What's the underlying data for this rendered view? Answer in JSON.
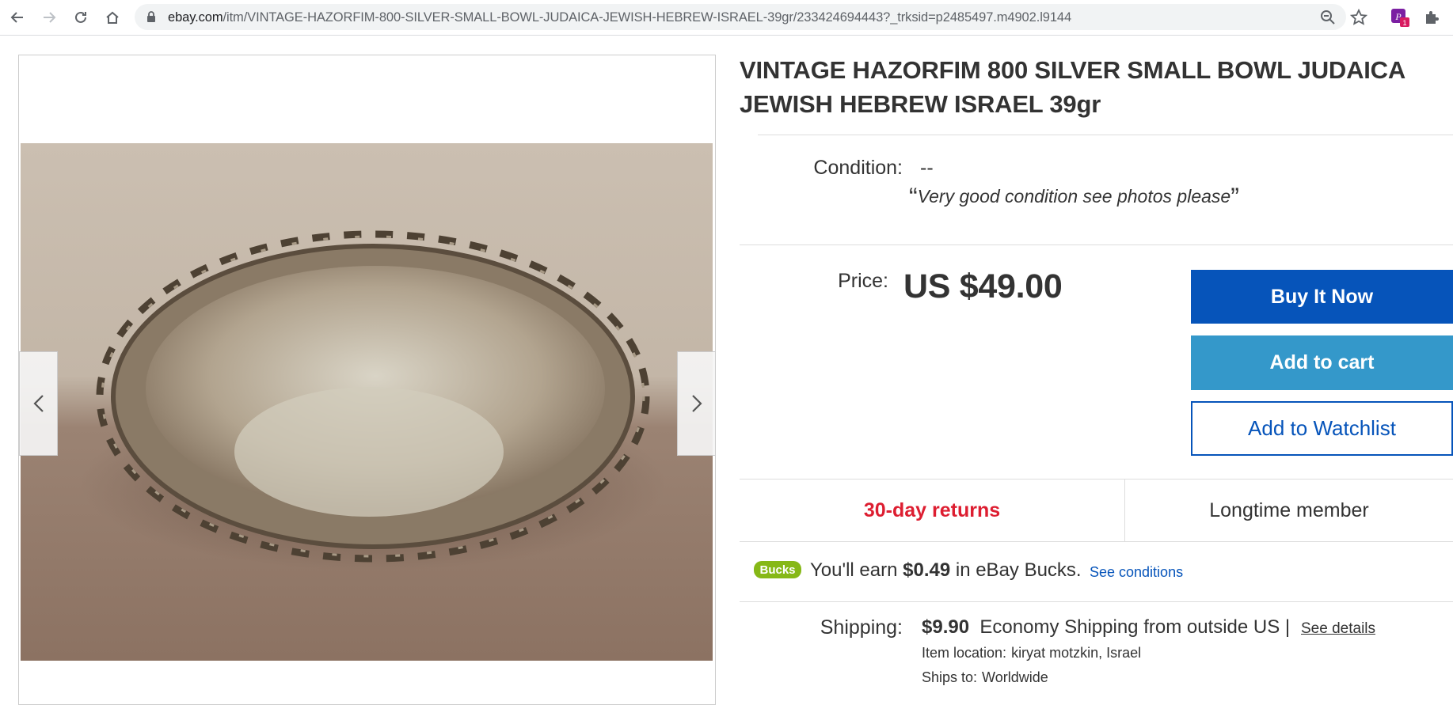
{
  "browser": {
    "url_host": "ebay.com",
    "url_path": "/itm/VINTAGE-HAZORFIM-800-SILVER-SMALL-BOWL-JUDAICA-JEWISH-HEBREW-ISRAEL-39gr/233424694443?_trksid=p2485497.m4902.l9144",
    "extension_badge": "1"
  },
  "listing": {
    "title": "VINTAGE HAZORFIM 800 SILVER SMALL BOWL JUDAICA JEWISH HEBREW ISRAEL 39gr",
    "condition_label": "Condition:",
    "condition_value": "--",
    "condition_note": "Very good condition see photos please",
    "price_label": "Price:",
    "price": "US $49.00",
    "buy_now": "Buy It Now",
    "add_to_cart": "Add to cart",
    "add_to_watchlist": "Add to Watchlist",
    "returns": "30-day returns",
    "member": "Longtime member",
    "bucks_logo": "Bucks",
    "bucks_prefix": "You'll earn",
    "bucks_amount": "$0.49",
    "bucks_suffix": "in eBay Bucks.",
    "see_conditions": "See conditions",
    "shipping_label": "Shipping:",
    "shipping_amount": "$9.90",
    "shipping_desc": "Economy Shipping from outside US |",
    "see_details": "See details",
    "item_location_label": "Item location:",
    "item_location": "kiryat motzkin, Israel",
    "ships_to_label": "Ships to:",
    "ships_to": "Worldwide"
  },
  "colors": {
    "buy_now": "#0654ba",
    "add_to_cart": "#3498ca",
    "returns": "#dd1e31",
    "link": "#0654ba"
  }
}
